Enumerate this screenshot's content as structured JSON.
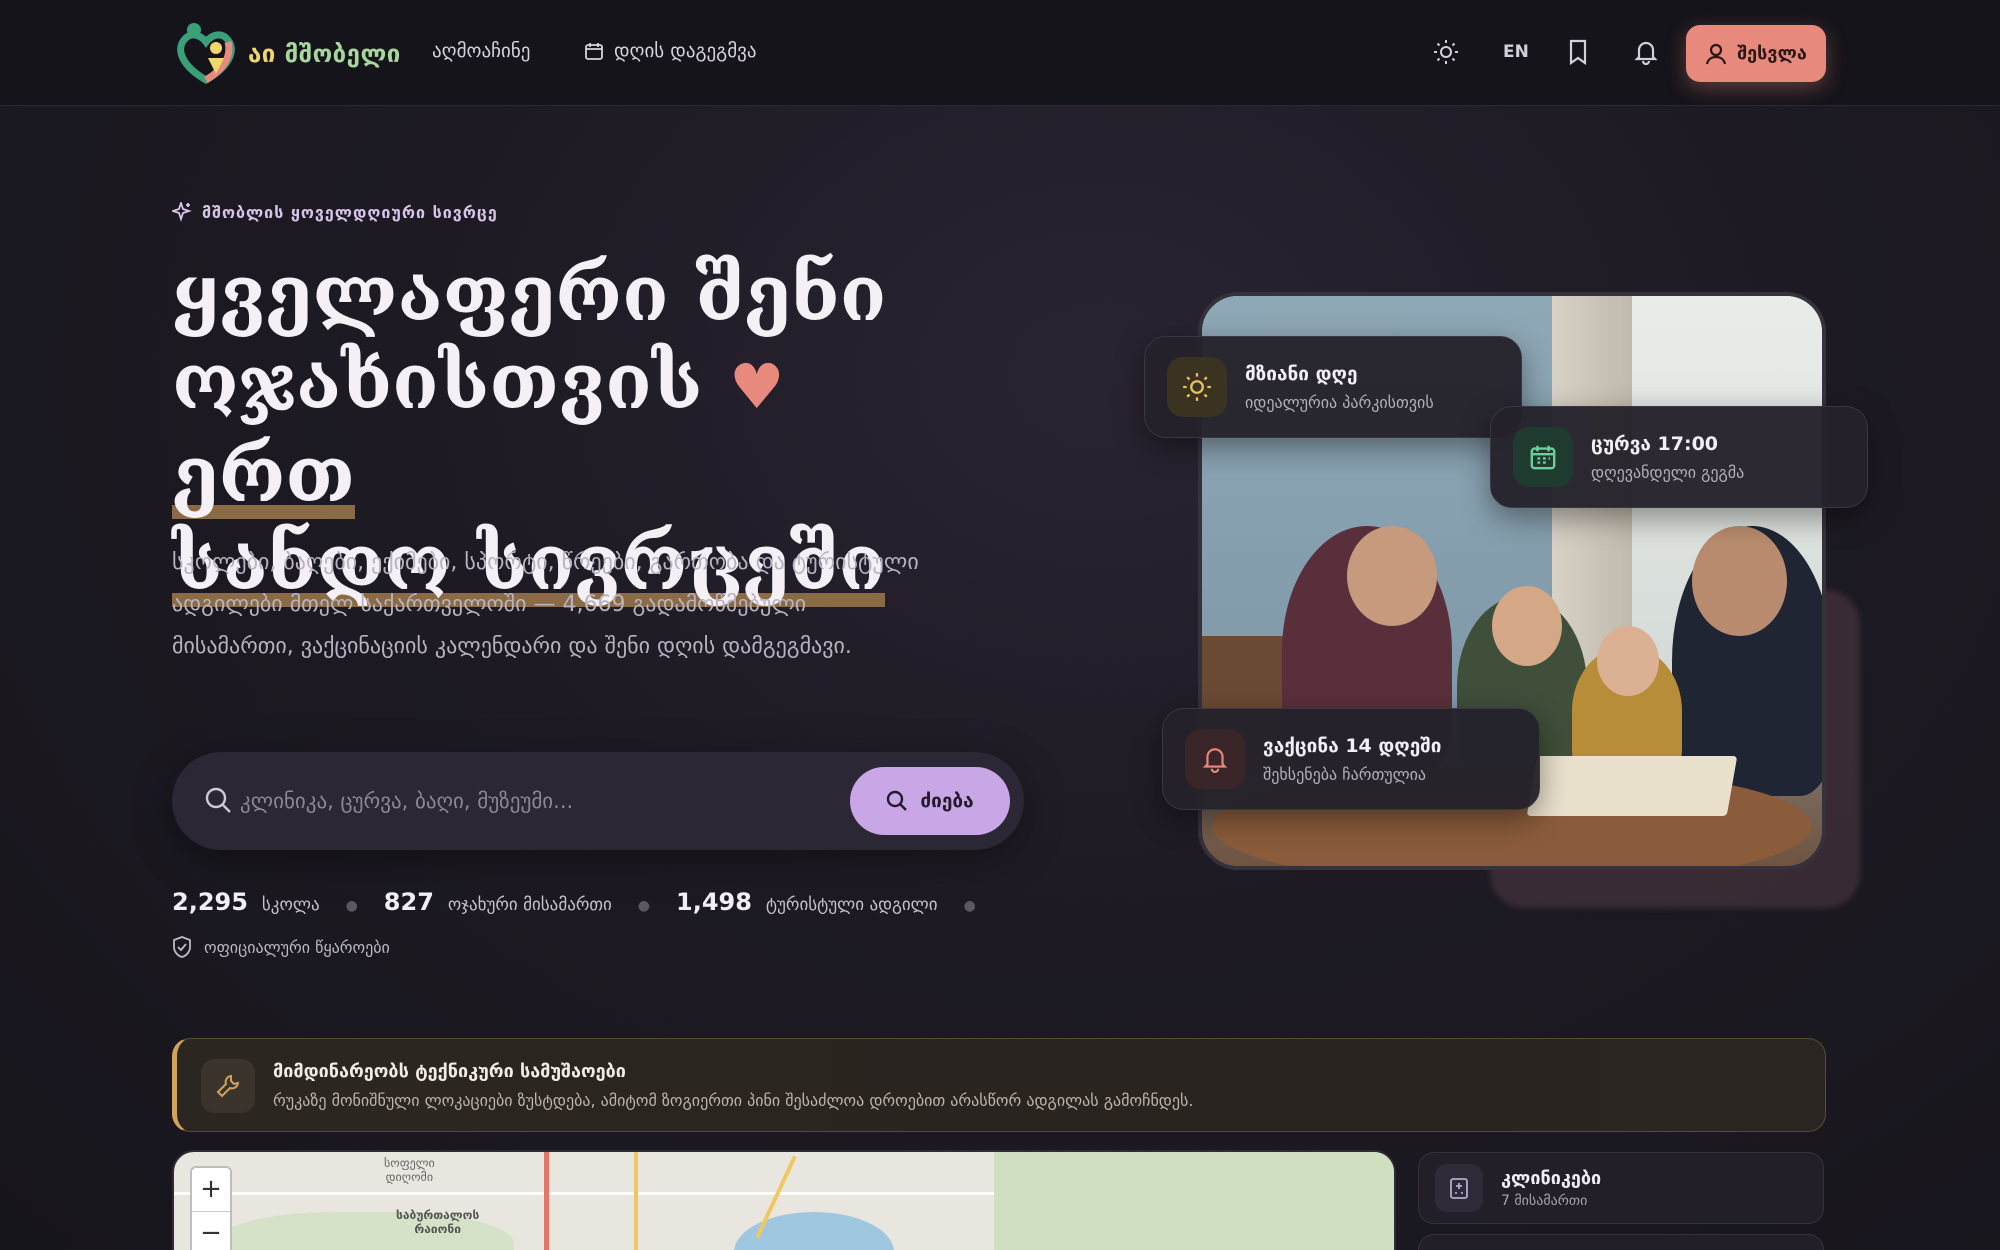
{
  "header": {
    "logo_text_1": "აი",
    "logo_text_2": "მშობელი",
    "nav_discover": "აღმოაჩინე",
    "nav_plan": "დღის დაგეგმვა",
    "lang": "EN",
    "login": "შესვლა",
    "icons": [
      "sun-icon",
      "bookmark-icon",
      "bell-icon",
      "user-icon",
      "calendar-icon"
    ]
  },
  "hero": {
    "eyebrow": "მშობლის ყოველდღიური სივრცე",
    "title_line1": "ყველაფერი შენი",
    "title_line2a": "ოჯახისთვის",
    "title_line2b": "ერთ",
    "title_line3": "სანდო სივრცეში",
    "description": "სკოლები, ბაღები, ექიმები, სპორტი, წრეები, გართობა და ტურისტული ადგილები მთელ საქართველოში — 4,669 გადამოწმებული მისამართი, ვაქცინაციის კალენდარი და შენი დღის დამგეგმავი.",
    "search_placeholder": "კლინიკა, ცურვა, ბაღი, მუზეუმი...",
    "search_button": "ძიება"
  },
  "stats": [
    {
      "value": "2,295",
      "label": "სკოლა"
    },
    {
      "value": "827",
      "label": "ოჯახური მისამართი"
    },
    {
      "value": "1,498",
      "label": "ტურისტული ადგილი"
    }
  ],
  "official_sources": "ოფიციალური წყაროები",
  "cards": {
    "sunny": {
      "title": "მზიანი დღე",
      "sub": "იდეალურია პარკისთვის"
    },
    "swim": {
      "title": "ცურვა 17:00",
      "sub": "დღევანდელი გეგმა"
    },
    "vaccine": {
      "title": "ვაქცინა 14 დღეში",
      "sub": "შეხსენება ჩართულია"
    }
  },
  "notice": {
    "title": "მიმდინარეობს ტექნიკური სამუშაოები",
    "text": "რუკაზე მონიშნული ლოკაციები ზუსტდება, ამიტომ ზოგიერთი პინი შესაძლოა დროებით არასწორ ადგილას გამოჩნდეს."
  },
  "map": {
    "zoom_in": "+",
    "zoom_out": "−",
    "label_1": "სოფელი\nდიღომი",
    "label_2": "საბურთალოს\nრაიონი"
  },
  "sidebar": {
    "clinics_title": "კლინიკები",
    "clinics_count": "7 მისამართი"
  },
  "colors": {
    "accent_coral": "#e8897e",
    "accent_lilac": "#c9a7e6",
    "notice_gold": "#d0a25a",
    "background": "#1d1a23"
  }
}
